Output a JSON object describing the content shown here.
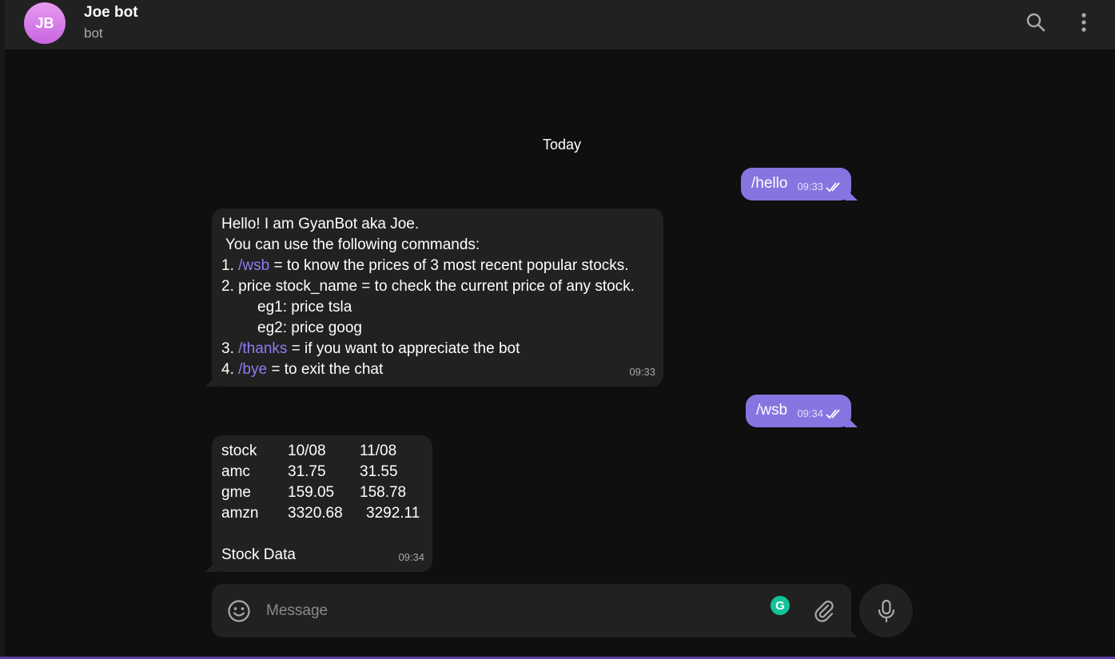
{
  "header": {
    "avatar_initials": "JB",
    "title": "Joe bot",
    "subtitle": "bot"
  },
  "date_separator": "Today",
  "messages": {
    "out1": {
      "text": "/hello",
      "time": "09:33"
    },
    "in1": {
      "line1": "Hello! I am GyanBot aka Joe.",
      "line2": " You can use the following commands:",
      "line3_prefix": "1. ",
      "line3_cmd": "/wsb",
      "line3_rest": " = to know the prices of 3 most recent popular stocks.",
      "line4": "2. price stock_name = to check the current price of any stock.",
      "line5": "eg1: price tsla",
      "line6": "eg2: price goog",
      "line7_prefix": "3. ",
      "line7_cmd": "/thanks",
      "line7_rest": " = if you want to appreciate the bot",
      "line8_prefix": "4. ",
      "line8_cmd": "/bye",
      "line8_rest": " = to exit the chat",
      "time": "09:33"
    },
    "out2": {
      "text": "/wsb",
      "time": "09:34"
    },
    "in2": {
      "rows": [
        [
          "stock",
          "10/08",
          "11/08"
        ],
        [
          "amc",
          "31.75",
          "31.55"
        ],
        [
          "gme",
          "159.05",
          "158.78"
        ],
        [
          "amzn",
          "3320.68",
          "3292.11"
        ]
      ],
      "footer": "Stock Data",
      "time": "09:34"
    }
  },
  "composer": {
    "placeholder": "Message",
    "grammarly_letter": "G"
  },
  "colors": {
    "accent": "#8774e1",
    "background": "#0f0f0f",
    "panel": "#212121",
    "command_link": "#8d7df0"
  },
  "icons": [
    "search-icon",
    "more-vertical-icon",
    "emoji-icon",
    "attach-icon",
    "microphone-icon",
    "double-check-icon",
    "grammarly-icon"
  ]
}
